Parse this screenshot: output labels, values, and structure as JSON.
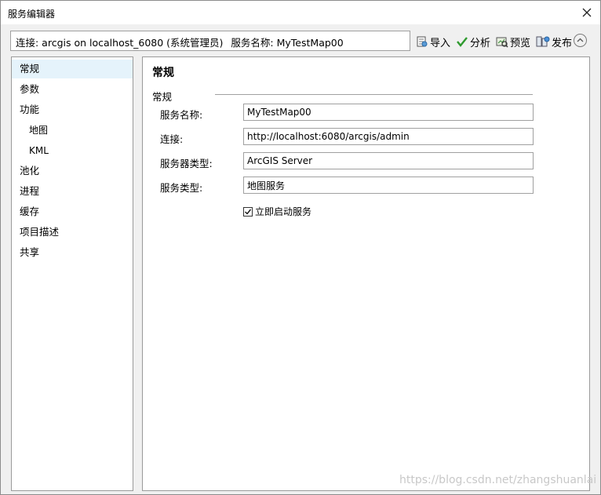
{
  "window": {
    "title": "服务编辑器"
  },
  "connection_bar": {
    "connection_text": "连接: arcgis on localhost_6080 (系统管理员)",
    "service_name_text": "服务名称: MyTestMap00"
  },
  "toolbar": {
    "import_label": "导入",
    "analyze_label": "分析",
    "preview_label": "预览",
    "publish_label": "发布"
  },
  "sidebar": {
    "items": [
      {
        "label": "常规"
      },
      {
        "label": "参数"
      },
      {
        "label": "功能"
      },
      {
        "label": "地图"
      },
      {
        "label": "KML"
      },
      {
        "label": "池化"
      },
      {
        "label": "进程"
      },
      {
        "label": "缓存"
      },
      {
        "label": "项目描述"
      },
      {
        "label": "共享"
      }
    ]
  },
  "main": {
    "title": "常规",
    "group_title": "常规",
    "fields": [
      {
        "label": "服务名称:",
        "value": "MyTestMap00"
      },
      {
        "label": "连接:",
        "value": "http://localhost:6080/arcgis/admin"
      },
      {
        "label": "服务器类型:",
        "value": "ArcGIS Server"
      },
      {
        "label": "服务类型:",
        "value": "地图服务"
      }
    ],
    "start_service": {
      "label": "立即启动服务",
      "checked": true
    }
  },
  "watermark": "https://blog.csdn.net/zhangshuanlai"
}
